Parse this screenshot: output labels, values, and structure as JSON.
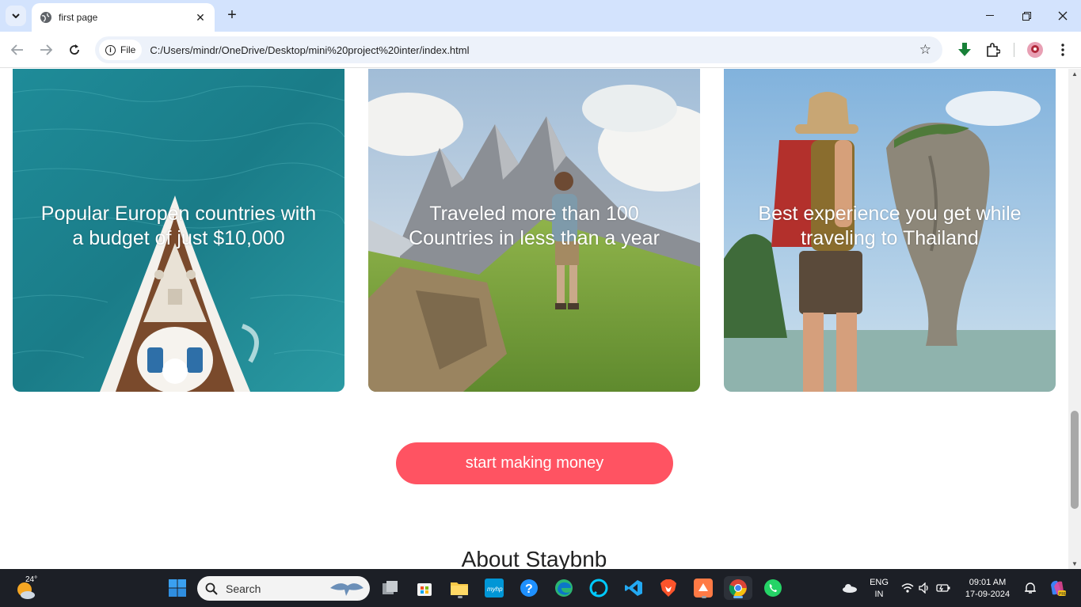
{
  "browser": {
    "tab_title": "first page",
    "url_chip": "File",
    "url": "C:/Users/mindr/OneDrive/Desktop/mini%20project%20inter/index.html"
  },
  "cards": [
    {
      "caption": "Popular Europen countries with a budget of just $10,000",
      "image": "boat-aerial-sea"
    },
    {
      "caption": "Traveled more than 100 Countries in less than a year",
      "image": "hiker-mountains"
    },
    {
      "caption": "Best experience you get while traveling to Thailand",
      "image": "backpacker-thailand-rock"
    }
  ],
  "cta": {
    "label": "start making money"
  },
  "about": {
    "heading": "About Staybnb"
  },
  "taskbar": {
    "weather_temp": "24°",
    "search_label": "Search",
    "lang_top": "ENG",
    "lang_bottom": "IN",
    "time": "09:01 AM",
    "date": "17-09-2024"
  },
  "colors": {
    "accent": "#ff5362",
    "tabbar": "#d3e3fd",
    "taskbar": "#1c1f26"
  }
}
